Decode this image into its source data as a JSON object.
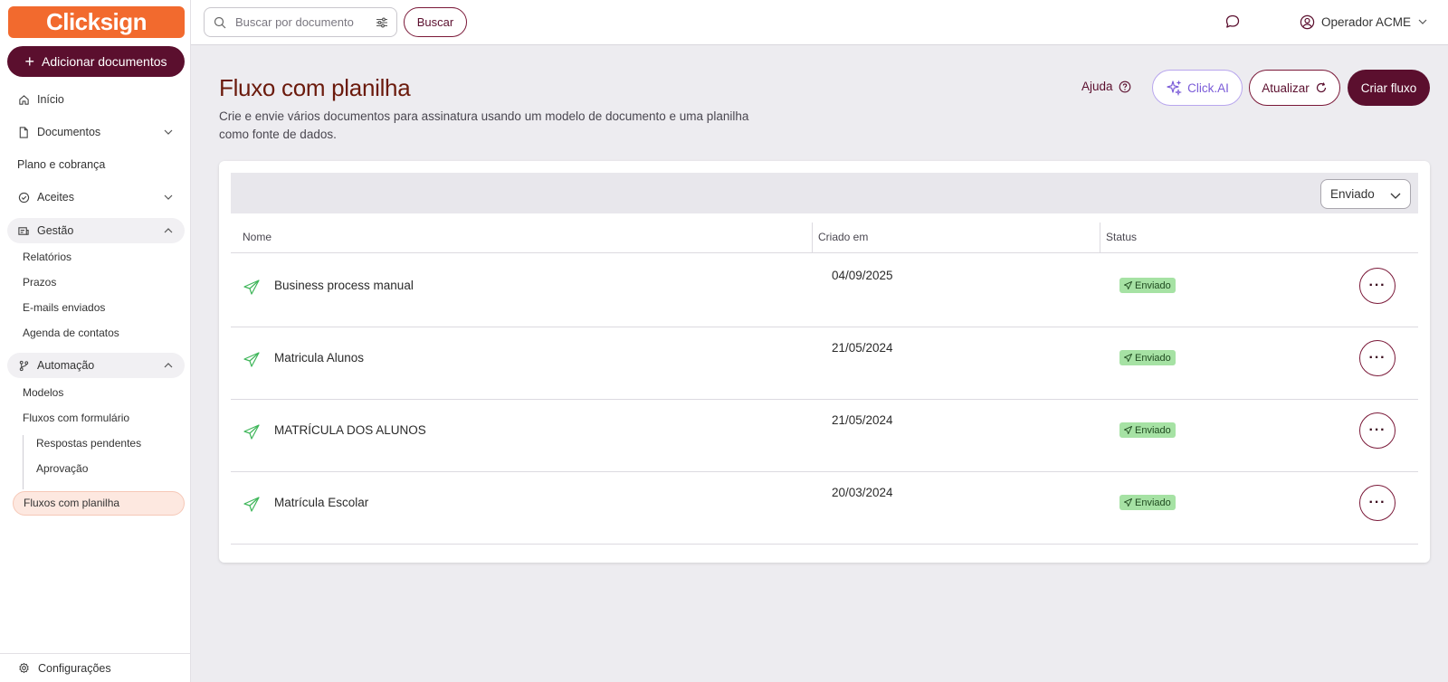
{
  "brand": {
    "logo_text": "Clicksign",
    "accent": "#5b0f2e",
    "orange": "#f26a2e"
  },
  "sidebar": {
    "add_button": "Adicionar documentos",
    "items": [
      {
        "label": "Início"
      },
      {
        "label": "Documentos"
      },
      {
        "label": "Plano e cobrança"
      },
      {
        "label": "Aceites"
      },
      {
        "label": "Gestão"
      },
      {
        "label": "Automação"
      }
    ],
    "gestao_sub": [
      "Relatórios",
      "Prazos",
      "E-mails enviados",
      "Agenda de contatos"
    ],
    "automacao_sub": [
      "Modelos",
      "Fluxos com formulário"
    ],
    "formulario_sub": [
      "Respostas pendentes",
      "Aprovação"
    ],
    "active": "Fluxos com planilha",
    "config": "Configurações"
  },
  "topbar": {
    "search_placeholder": "Buscar por documento",
    "search_button": "Buscar",
    "user_name": "Operador ACME"
  },
  "header": {
    "title": "Fluxo com planilha",
    "description": "Crie e envie vários documentos para assinatura usando um modelo de documento e uma planilha como fonte de dados.",
    "help": "Ajuda",
    "clickai": "Click.AI",
    "refresh": "Atualizar",
    "create": "Criar fluxo"
  },
  "table": {
    "filter_value": "Enviado",
    "columns": [
      "Nome",
      "Criado em",
      "Status"
    ],
    "rows": [
      {
        "name": "Business process manual",
        "created": "04/09/2025",
        "status": "Enviado"
      },
      {
        "name": "Matricula Alunos",
        "created": "21/05/2024",
        "status": "Enviado"
      },
      {
        "name": "MATRÍCULA DOS ALUNOS",
        "created": "21/05/2024",
        "status": "Enviado"
      },
      {
        "name": "Matrícula Escolar",
        "created": "20/03/2024",
        "status": "Enviado"
      }
    ],
    "more_label": "···"
  }
}
